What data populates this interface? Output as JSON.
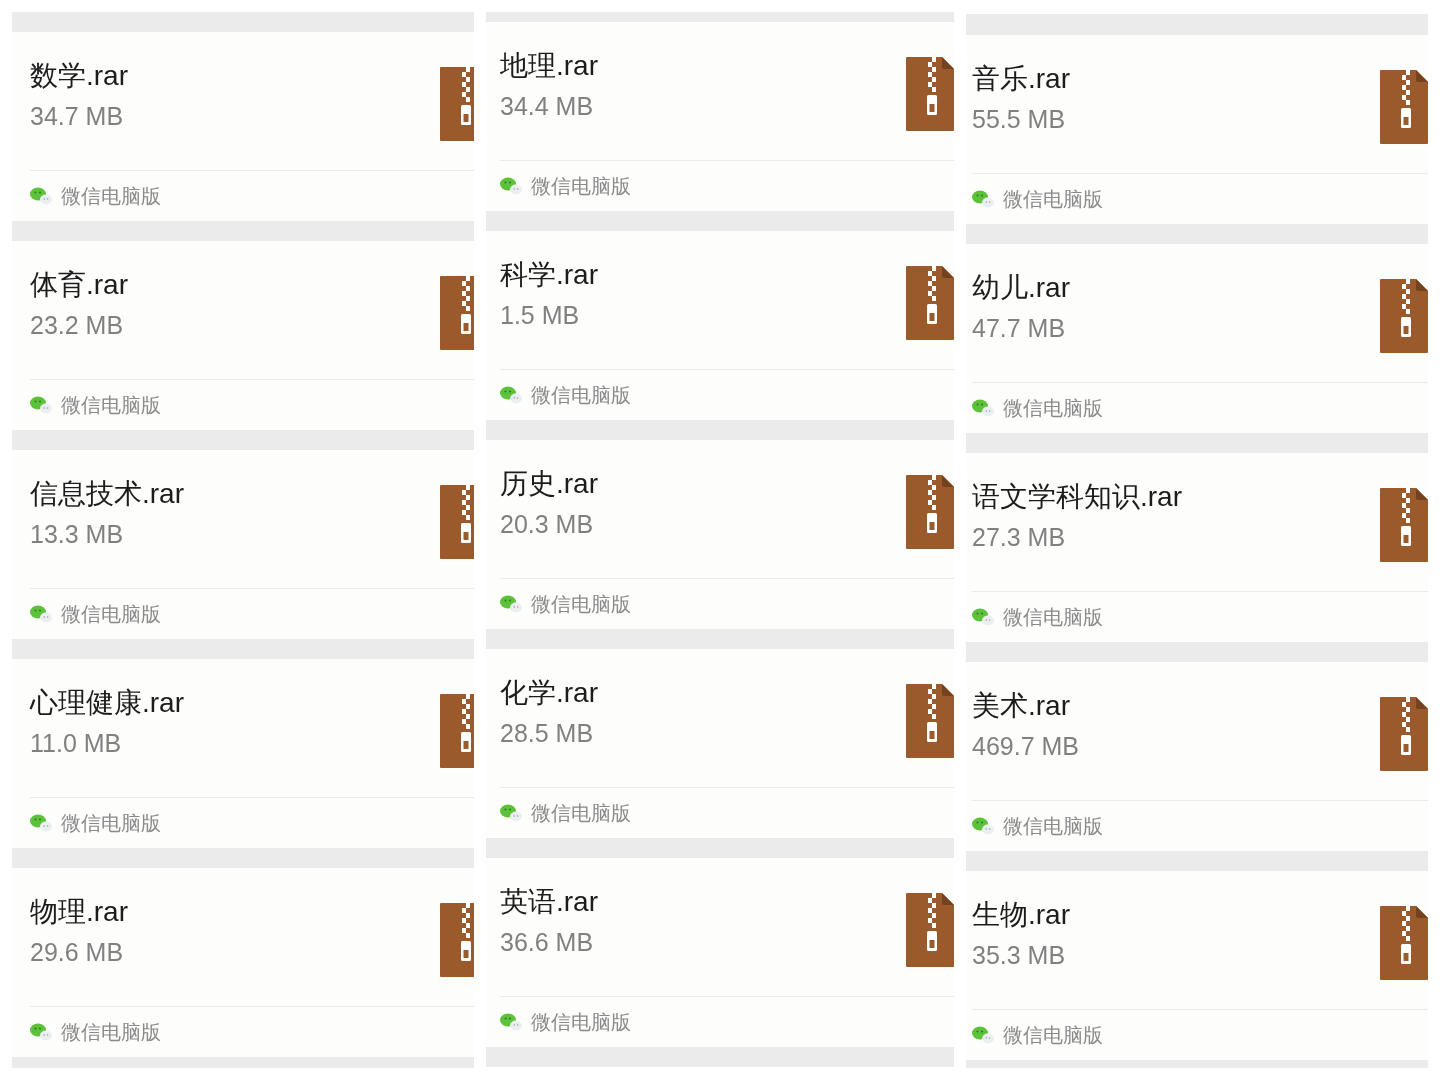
{
  "columns": [
    {
      "files": [
        {
          "name": "数学.rar",
          "size": "34.7 MB",
          "source": "微信电脑版"
        },
        {
          "name": "体育.rar",
          "size": "23.2 MB",
          "source": "微信电脑版"
        },
        {
          "name": "信息技术.rar",
          "size": "13.3 MB",
          "source": "微信电脑版"
        },
        {
          "name": "心理健康.rar",
          "size": "11.0 MB",
          "source": "微信电脑版"
        },
        {
          "name": "物理.rar",
          "size": "29.6 MB",
          "source": "微信电脑版"
        }
      ]
    },
    {
      "files": [
        {
          "name": "地理.rar",
          "size": "34.4 MB",
          "source": "微信电脑版"
        },
        {
          "name": "科学.rar",
          "size": "1.5 MB",
          "source": "微信电脑版"
        },
        {
          "name": "历史.rar",
          "size": "20.3 MB",
          "source": "微信电脑版"
        },
        {
          "name": "化学.rar",
          "size": "28.5 MB",
          "source": "微信电脑版"
        },
        {
          "name": "英语.rar",
          "size": "36.6 MB",
          "source": "微信电脑版"
        }
      ]
    },
    {
      "files": [
        {
          "name": "音乐.rar",
          "size": "55.5 MB",
          "source": "微信电脑版"
        },
        {
          "name": "幼儿.rar",
          "size": "47.7 MB",
          "source": "微信电脑版"
        },
        {
          "name": "语文学科知识.rar",
          "size": "27.3 MB",
          "source": "微信电脑版"
        },
        {
          "name": "美术.rar",
          "size": "469.7 MB",
          "source": "微信电脑版"
        },
        {
          "name": "生物.rar",
          "size": "35.3 MB",
          "source": "微信电脑版"
        }
      ]
    }
  ]
}
